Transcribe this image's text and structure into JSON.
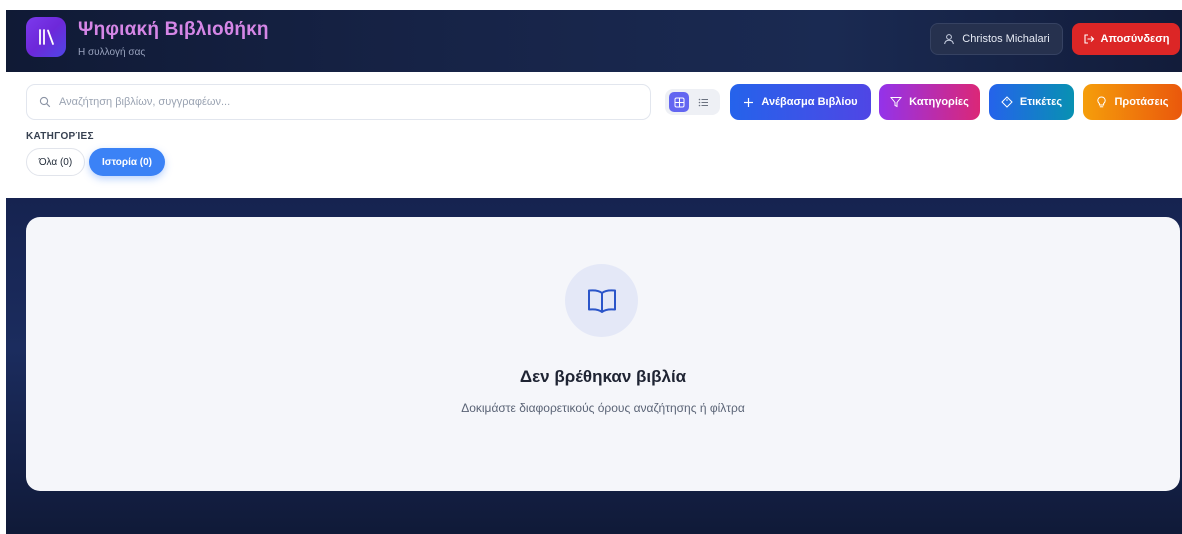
{
  "app": {
    "title": "Ψηφιακή Βιβλιοθήκη",
    "subtitle": "Η συλλογή σας",
    "logo_icon": "library-icon"
  },
  "header": {
    "user_name": "Christos Michalari",
    "user_icon": "user-icon",
    "logout_label": "Αποσύνδεση",
    "logout_icon": "logout-icon"
  },
  "search": {
    "placeholder": "Αναζήτηση βιβλίων, συγγραφέων...",
    "value": ""
  },
  "view_toggle": {
    "active": "grid",
    "options": [
      "grid",
      "list"
    ]
  },
  "actions": {
    "upload_label": "Ανέβασμα Βιβλίου",
    "categories_label": "Κατηγορίες",
    "tags_label": "Ετικέτες",
    "suggestions_label": "Προτάσεις"
  },
  "categories": {
    "heading": "ΚΑΤΗΓΟΡΊΕΣ",
    "chips": [
      {
        "label": "Όλα (0)",
        "active": false
      },
      {
        "label": "Ιστορία (0)",
        "active": true
      }
    ]
  },
  "empty_state": {
    "icon": "open-book-icon",
    "title": "Δεν βρέθηκαν βιβλία",
    "message": "Δοκιμάστε διαφορετικούς όρους αναζήτησης ή φίλτρα"
  },
  "colors": {
    "header_bg": "#172448",
    "accent_purple": "#7c3aed",
    "logout_red": "#dc2626",
    "upload_blue": "#2563eb",
    "categories_magenta": "#9333ea",
    "tags_cyan": "#0891b2",
    "suggestions_orange": "#f59e0b",
    "chip_active": "#3b82f6"
  }
}
